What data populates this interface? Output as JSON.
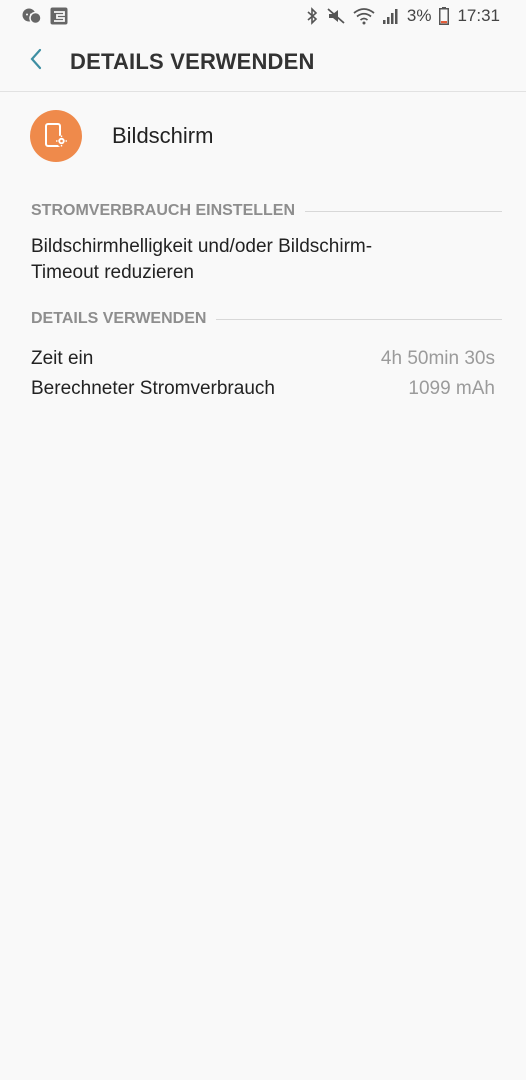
{
  "status_bar": {
    "left_icons": [
      "messenger-icon",
      "calendar-icon"
    ],
    "right_icons": [
      "bluetooth-icon",
      "mute-icon",
      "wifi-icon",
      "signal-icon",
      "battery-icon"
    ],
    "battery_percent": "3%",
    "time": "17:31"
  },
  "header": {
    "title": "DETAILS VERWENDEN"
  },
  "app": {
    "name": "Bildschirm",
    "icon_color": "#ef8a4b"
  },
  "sections": {
    "adjust_header": "STROMVERBRAUCH EINSTELLEN",
    "adjust_suggestion_line1": "Bildschirmhelligkeit und/oder Bildschirm-",
    "adjust_suggestion_line2": "Timeout reduzieren",
    "details_header": "DETAILS VERWENDEN"
  },
  "details": [
    {
      "label": "Zeit ein",
      "value": "4h 50min 30s"
    },
    {
      "label": "Berechneter Stromverbrauch",
      "value": "1099 mAh"
    }
  ],
  "colors": {
    "accent": "#3e8fa3",
    "background": "#f9f9f9"
  }
}
